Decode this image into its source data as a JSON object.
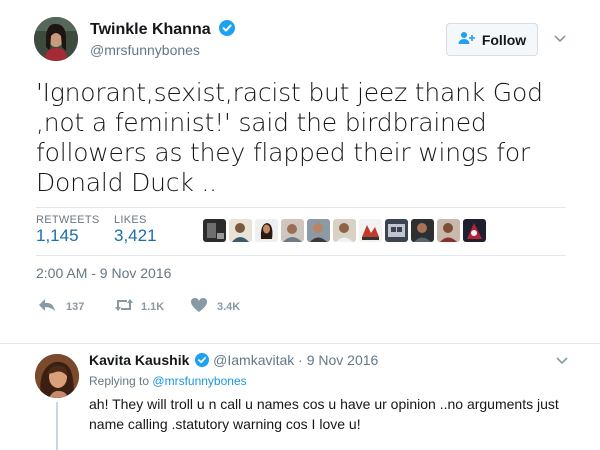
{
  "tweet": {
    "author_name": "Twinkle Khanna",
    "handle": "@mrsfunnybones",
    "follow_label": "Follow",
    "text": "'Ignorant,sexist,racist but jeez thank God ,not a feminist!' said the birdbrained followers as they flapped their wings for Donald Duck ..",
    "retweets_label": "RETWEETS",
    "retweets_count": "1,145",
    "likes_label": "LIKES",
    "likes_count": "3,421",
    "timestamp": "2:00 AM - 9 Nov 2016",
    "actions": {
      "reply_count": "137",
      "retweet_count": "1.1K",
      "like_count": "3.4K"
    }
  },
  "reply": {
    "author_name": "Kavita Kaushik",
    "handle": "@Iamkavitak",
    "date": "· 9 Nov 2016",
    "replying_prefix": "Replying to",
    "replying_handle": "@mrsfunnybones",
    "text": "ah! They will troll u n call u names cos u have ur opinion ..no arguments just name calling .statutory warning cos I love u!"
  },
  "colors": {
    "accent": "#1da1f2",
    "link": "#1b95e0",
    "muted": "#657786"
  },
  "icons": [
    "verified-badge-icon",
    "follow-user-icon",
    "chevron-down-icon",
    "reply-icon",
    "retweet-icon",
    "heart-icon"
  ]
}
